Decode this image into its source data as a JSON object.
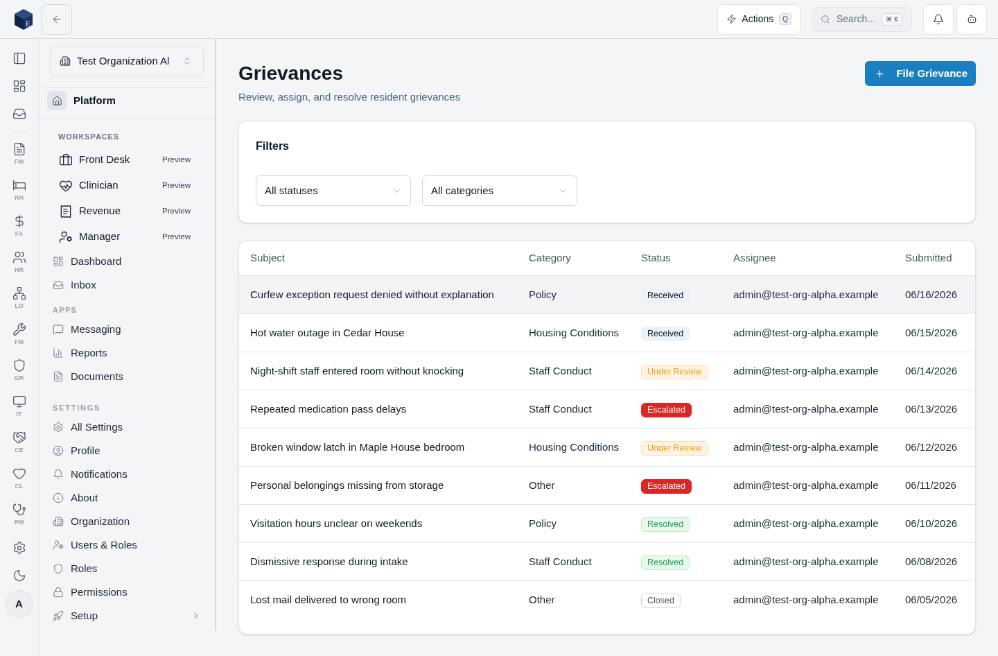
{
  "topbar": {
    "logo_mark": "E",
    "actions": {
      "label": "Actions",
      "shortcut": "Q"
    },
    "search": {
      "label": "Search...",
      "shortcut": "⌘ K"
    }
  },
  "rail": {
    "apps": [
      {
        "label": "FW"
      },
      {
        "label": "RH"
      },
      {
        "label": "FA"
      },
      {
        "label": "HR"
      },
      {
        "label": "LO"
      },
      {
        "label": "FM"
      },
      {
        "label": "GR"
      },
      {
        "label": "IT"
      },
      {
        "label": "CE"
      },
      {
        "label": "CL"
      },
      {
        "label": "PM"
      }
    ],
    "avatar": "A"
  },
  "sidebar": {
    "org_name": "Test Organization Al",
    "platform": "Platform",
    "sections": [
      {
        "title": "WORKSPACES",
        "items": [
          {
            "kind": "workspace",
            "label": "Front Desk",
            "badge": "Preview"
          },
          {
            "kind": "workspace",
            "label": "Clinician",
            "badge": "Preview"
          },
          {
            "kind": "workspace",
            "label": "Revenue",
            "badge": "Preview"
          },
          {
            "kind": "workspace",
            "label": "Manager",
            "badge": "Preview"
          },
          {
            "kind": "link",
            "label": "Dashboard"
          },
          {
            "kind": "link",
            "label": "Inbox"
          }
        ]
      },
      {
        "title": "APPS",
        "items": [
          {
            "kind": "link",
            "label": "Messaging"
          },
          {
            "kind": "link",
            "label": "Reports"
          },
          {
            "kind": "link",
            "label": "Documents"
          }
        ]
      },
      {
        "title": "SETTINGS",
        "items": [
          {
            "kind": "link",
            "label": "All Settings"
          },
          {
            "kind": "link",
            "label": "Profile"
          },
          {
            "kind": "link",
            "label": "Notifications"
          },
          {
            "kind": "link",
            "label": "About"
          },
          {
            "kind": "link",
            "label": "Organization"
          },
          {
            "kind": "link",
            "label": "Users & Roles"
          },
          {
            "kind": "link",
            "label": "Roles"
          },
          {
            "kind": "link",
            "label": "Permissions"
          },
          {
            "kind": "group",
            "label": "Setup",
            "expanded": false
          }
        ]
      }
    ]
  },
  "page": {
    "title": "Grievances",
    "subtitle": "Review, assign, and resolve resident grievances",
    "primary_action": "File Grievance"
  },
  "filters": {
    "title": "Filters",
    "selects": [
      {
        "value": "All statuses"
      },
      {
        "value": "All categories"
      }
    ]
  },
  "table": {
    "columns": [
      "Subject",
      "Category",
      "Status",
      "Assignee",
      "Submitted"
    ],
    "rows": [
      {
        "subject": "Curfew exception request denied without explanation",
        "category": "Policy",
        "status": {
          "label": "Received",
          "kind": "neutral"
        },
        "assignee": "admin@test-org-alpha.example",
        "submitted": "06/16/2026",
        "highlighted": true
      },
      {
        "subject": "Hot water outage in Cedar House",
        "category": "Housing Conditions",
        "status": {
          "label": "Received",
          "kind": "neutral"
        },
        "assignee": "admin@test-org-alpha.example",
        "submitted": "06/15/2026",
        "highlighted": false
      },
      {
        "subject": "Night-shift staff entered room without knocking",
        "category": "Staff Conduct",
        "status": {
          "label": "Under Review",
          "kind": "warning"
        },
        "assignee": "admin@test-org-alpha.example",
        "submitted": "06/14/2026",
        "highlighted": false
      },
      {
        "subject": "Repeated medication pass delays",
        "category": "Staff Conduct",
        "status": {
          "label": "Escalated",
          "kind": "danger"
        },
        "assignee": "admin@test-org-alpha.example",
        "submitted": "06/13/2026",
        "highlighted": false
      },
      {
        "subject": "Broken window latch in Maple House bedroom",
        "category": "Housing Conditions",
        "status": {
          "label": "Under Review",
          "kind": "warning"
        },
        "assignee": "admin@test-org-alpha.example",
        "submitted": "06/12/2026",
        "highlighted": false
      },
      {
        "subject": "Personal belongings missing from storage",
        "category": "Other",
        "status": {
          "label": "Escalated",
          "kind": "danger"
        },
        "assignee": "admin@test-org-alpha.example",
        "submitted": "06/11/2026",
        "highlighted": false
      },
      {
        "subject": "Visitation hours unclear on weekends",
        "category": "Policy",
        "status": {
          "label": "Resolved",
          "kind": "success"
        },
        "assignee": "admin@test-org-alpha.example",
        "submitted": "06/10/2026",
        "highlighted": false
      },
      {
        "subject": "Dismissive response during intake",
        "category": "Staff Conduct",
        "status": {
          "label": "Resolved",
          "kind": "success"
        },
        "assignee": "admin@test-org-alpha.example",
        "submitted": "06/08/2026",
        "highlighted": false
      },
      {
        "subject": "Lost mail delivered to wrong room",
        "category": "Other",
        "status": {
          "label": "Closed",
          "kind": "outline"
        },
        "assignee": "admin@test-org-alpha.example",
        "submitted": "06/05/2026",
        "highlighted": false
      }
    ]
  }
}
